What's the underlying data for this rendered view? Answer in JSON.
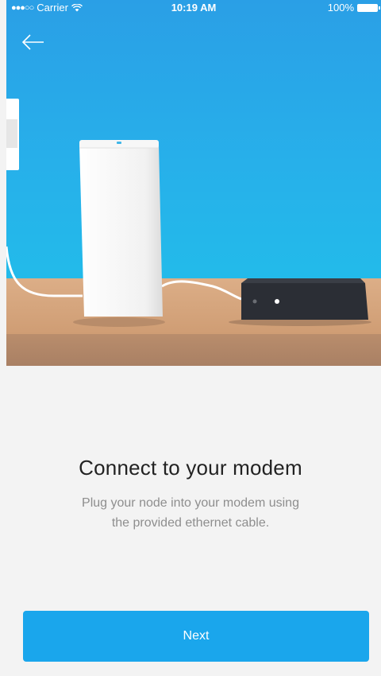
{
  "status_bar": {
    "signal": "●●●○○",
    "carrier": "Carrier",
    "time": "10:19 AM",
    "battery": "100%"
  },
  "navigation": {
    "back_icon": "arrow-left-icon"
  },
  "illustration": {
    "node_light_color": "#3fb6e8",
    "modem_color": "#2b2e35",
    "shelf_color": "#d4a582"
  },
  "content": {
    "title": "Connect to your modem",
    "description": "Plug your node into your modem using the provided ethernet cable."
  },
  "footer": {
    "next_label": "Next"
  },
  "colors": {
    "accent": "#1aa6ec",
    "background": "#f3f3f3"
  }
}
